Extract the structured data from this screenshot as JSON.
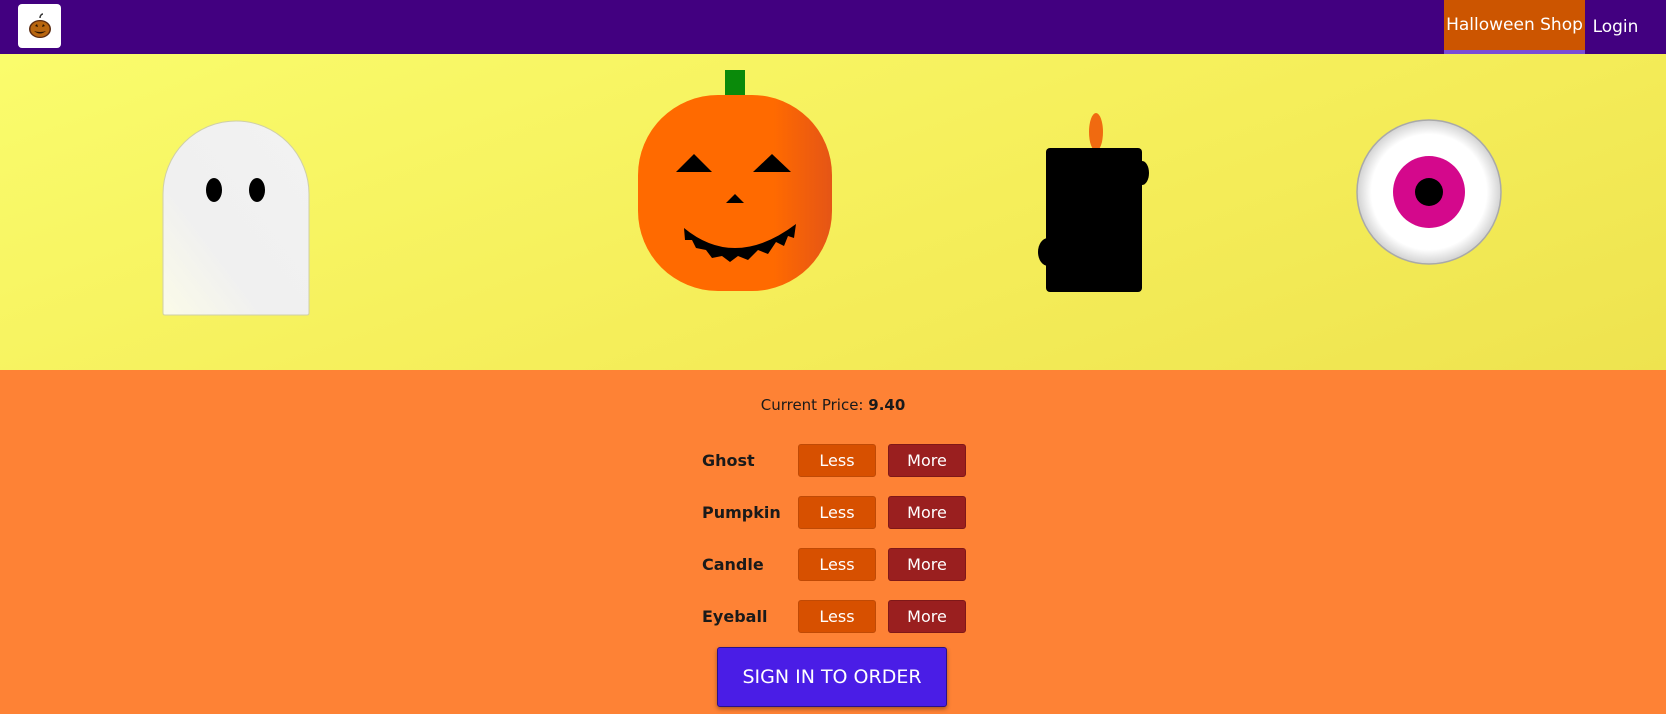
{
  "nav": {
    "logo_icon": "pumpkin-logo-icon",
    "links": [
      {
        "label": "Halloween Shop",
        "active": true
      },
      {
        "label": "Login",
        "active": false
      }
    ]
  },
  "hero": {
    "items": [
      "ghost",
      "pumpkin",
      "candle",
      "eyeball"
    ]
  },
  "order": {
    "price_label": "Current Price:",
    "price_value": "9.40",
    "rows": [
      {
        "label": "Ghost",
        "less": "Less",
        "more": "More"
      },
      {
        "label": "Pumpkin",
        "less": "Less",
        "more": "More"
      },
      {
        "label": "Candle",
        "less": "Less",
        "more": "More"
      },
      {
        "label": "Eyeball",
        "less": "Less",
        "more": "More"
      }
    ],
    "submit_label": "SIGN IN TO ORDER"
  },
  "colors": {
    "nav": "#420080",
    "active_nav": "#cc5500",
    "hero": "#f5ee5a",
    "panel": "#fe8235",
    "less_button": "#d75000",
    "more_button": "#9a1f1f",
    "order_button": "#4a1de6"
  }
}
